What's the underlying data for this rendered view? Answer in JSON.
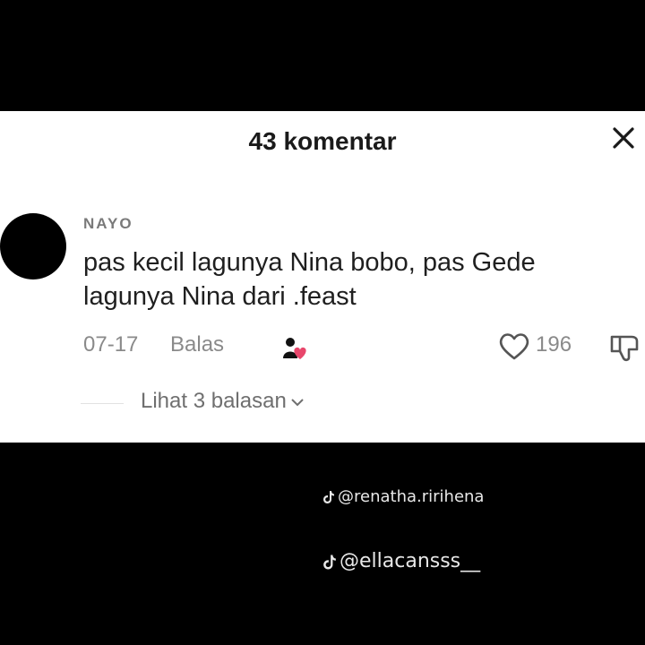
{
  "header": {
    "title": "43 komentar",
    "close_icon": "close-icon"
  },
  "comment": {
    "username": "NAYO",
    "text": "pas kecil lagunya Nina bobo, pas Gede lagunya Nina dari .feast",
    "date": "07-17",
    "reply_label": "Balas",
    "like_count": "196",
    "view_replies_label": "Lihat 3 balasan",
    "icons": [
      "avatar",
      "creator-liked-icon",
      "heart-icon",
      "dislike-icon",
      "chevron-down-icon"
    ]
  },
  "watermarks": [
    {
      "text": "@renatha.ririhena",
      "icon": "tiktok-icon"
    },
    {
      "text": "@ellacansss__",
      "icon": "tiktok-icon"
    }
  ],
  "colors": {
    "background": "#000000",
    "panel": "#ffffff",
    "muted_text": "#8a8a8a",
    "heart_pink": "#e8466b"
  }
}
